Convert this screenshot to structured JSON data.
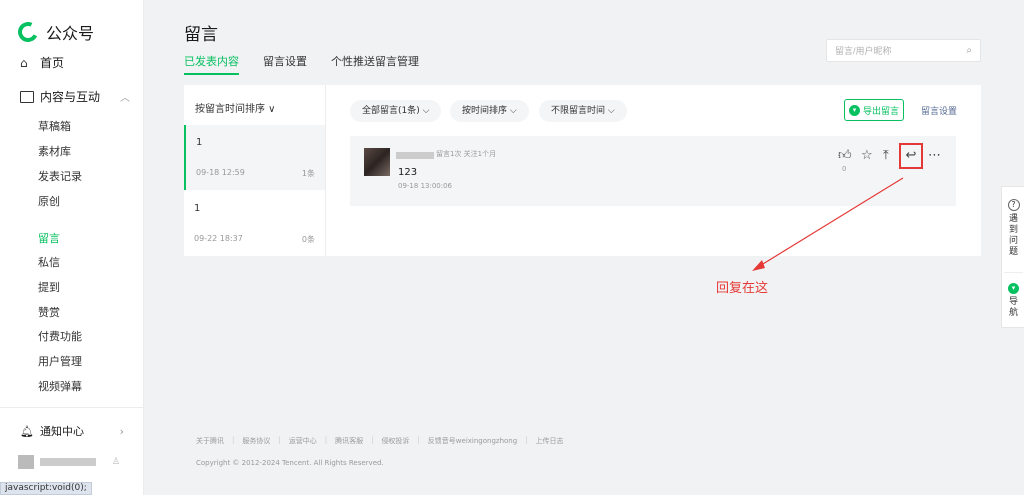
{
  "app": {
    "logo_text": "公众号"
  },
  "sidebar": {
    "home": "首页",
    "group": "内容与互动",
    "sub_items": [
      "草稿箱",
      "素材库",
      "发表记录",
      "原创",
      "留言",
      "私信",
      "提到",
      "赞赏",
      "付费功能",
      "用户管理",
      "视频弹幕"
    ],
    "active_item": "留言",
    "notice": "通知中心",
    "status_url": "javascript:void(0);"
  },
  "header": {
    "title": "留言",
    "tabs": [
      "已发表内容",
      "留言设置",
      "个性推送留言管理"
    ],
    "active_tab": "已发表内容",
    "search_placeholder": "留言/用户昵称"
  },
  "articles": {
    "sort_label": "按留言时间排序 ∨",
    "items": [
      {
        "title": "1",
        "date": "09-18 12:59",
        "count": "1条",
        "selected": true
      },
      {
        "title": "1",
        "date": "09-22 18:37",
        "count": "0条",
        "selected": false
      }
    ]
  },
  "filters": {
    "all": "全部留言(1条) ⌵",
    "sort": "按时间排序 ⌵",
    "time": "不限留言时间 ⌵",
    "export": "导出留言",
    "settings": "留言设置"
  },
  "comment": {
    "meta": "留言1次 关注1个月",
    "text": "123",
    "time": "09-18 13:00:06",
    "likes": "0"
  },
  "annotation": {
    "text": "回复在这"
  },
  "float_bar": {
    "help": [
      "遇",
      "到",
      "问",
      "题"
    ],
    "nav": [
      "导",
      "航"
    ]
  },
  "footer": {
    "links": [
      "关于腾讯",
      "服务协议",
      "运营中心",
      "腾讯客服",
      "侵权投诉",
      "反馈音号weixingongzhong",
      "上传日志"
    ],
    "copyright": "Copyright © 2012-2024 Tencent. All Rights Reserved."
  },
  "colors": {
    "accent": "#07c160",
    "annotation": "#e53935",
    "link": "#576b95"
  }
}
